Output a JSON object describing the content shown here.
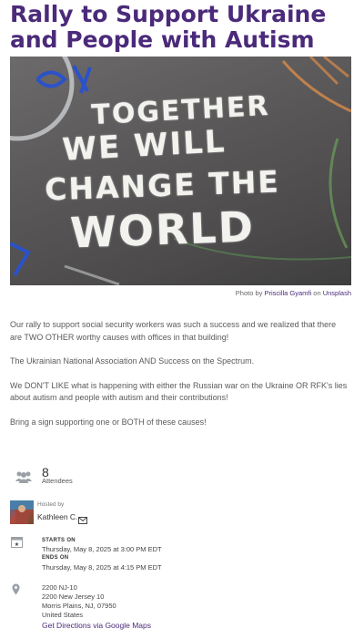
{
  "event": {
    "title": "Rally to Support Ukraine and People with Autism",
    "image_text": [
      "TOGETHER",
      "WE WILL",
      "CHANGE THE",
      "WORLD"
    ],
    "photo_credit": {
      "prefix": "Photo by",
      "author": "Priscilla Gyamfi",
      "on": "on",
      "source": "Unsplash"
    },
    "description": [
      "Our rally to support social security workers was such a success and we realized that there are TWO OTHER worthy causes  with offices in that building!",
      "The Ukrainian National Association AND Success on the Spectrum.",
      "We DON'T LIKE what is happening with either the Russian war on the Ukraine OR RFK's lies about autism and people with autism and their contributions!",
      "Bring a sign supporting one or BOTH of these causes!"
    ]
  },
  "attendees": {
    "count": "8",
    "label": "Attendees"
  },
  "host": {
    "label": "Hosted by",
    "name": "Kathleen C."
  },
  "schedule": {
    "starts_label": "STARTS ON",
    "starts_value": "Thursday, May 8, 2025 at 3:00 PM EDT",
    "ends_label": "ENDS ON",
    "ends_value": "Thursday, May 8, 2025 at 4:15 PM EDT"
  },
  "location": {
    "lines": [
      "2200 NJ-10",
      "2200 New Jersey 10",
      "Morris Plains, NJ, 07950",
      "United States"
    ],
    "directions_link": "Get Directions via Google Maps"
  },
  "colors": {
    "title": "#4b2a7a",
    "link": "#4b2a7a",
    "icon": "#9aa0a6"
  },
  "icons": [
    "people-icon",
    "mail-icon",
    "calendar-icon",
    "map-pin-icon"
  ]
}
